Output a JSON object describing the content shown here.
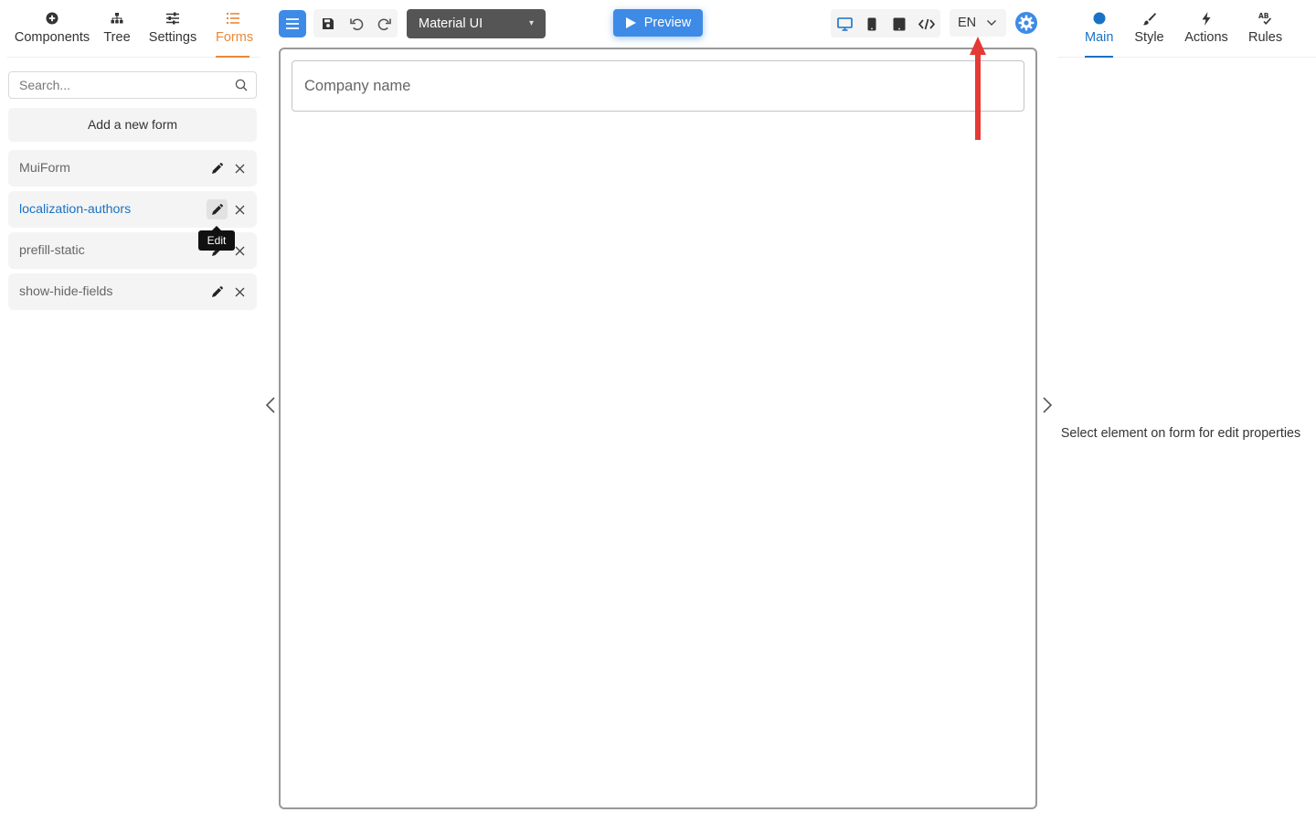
{
  "left_tabs": [
    {
      "label": "Components",
      "icon": "plus-circle-icon"
    },
    {
      "label": "Tree",
      "icon": "tree-icon"
    },
    {
      "label": "Settings",
      "icon": "sliders-icon"
    },
    {
      "label": "Forms",
      "icon": "list-icon",
      "active": true
    }
  ],
  "search": {
    "placeholder": "Search...",
    "value": ""
  },
  "add_form_label": "Add a new form",
  "forms": [
    {
      "name": "MuiForm"
    },
    {
      "name": "localization-authors",
      "active": true
    },
    {
      "name": "prefill-static"
    },
    {
      "name": "show-hide-fields"
    }
  ],
  "tooltip": "Edit",
  "toolbar": {
    "theme_value": "Material UI",
    "preview_label": "Preview",
    "language_value": "EN"
  },
  "canvas": {
    "field_placeholder": "Company name"
  },
  "right_tabs": [
    {
      "label": "Main",
      "icon": "circle-icon",
      "active": true
    },
    {
      "label": "Style",
      "icon": "brush-icon"
    },
    {
      "label": "Actions",
      "icon": "lightning-icon"
    },
    {
      "label": "Rules",
      "icon": "spellcheck-icon"
    }
  ],
  "properties_empty_text": "Select element on form for edit properties",
  "colors": {
    "accent_blue": "#3d8be6",
    "active_link": "#1a72c4",
    "forms_tab_orange": "#e8893a",
    "annotation_red": "#e53935"
  }
}
